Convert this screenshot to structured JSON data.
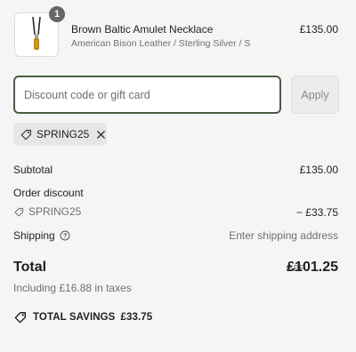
{
  "product": {
    "name": "Brown Baltic Amulet Necklace",
    "variant": "American Bison Leather / Sterling Silver / S",
    "price": "£135.00",
    "quantity": "1",
    "image_icon": "necklace-thumbnail"
  },
  "discount": {
    "placeholder": "Discount code or gift card",
    "value": "",
    "apply_label": "Apply"
  },
  "applied_code_chip": {
    "label": "SPRING25",
    "icon": "tag-icon",
    "remove_icon": "close-icon"
  },
  "summary": {
    "subtotal_label": "Subtotal",
    "subtotal_value": "£135.00",
    "order_discount_label": "Order discount",
    "discount_code": "SPRING25",
    "discount_value": "− £33.75",
    "shipping_label": "Shipping",
    "shipping_value": "Enter shipping address",
    "total_label": "Total",
    "currency": "GBP",
    "total_value": "£101.25",
    "taxes_note": "Including £16.88 in taxes",
    "savings_label": "TOTAL SAVINGS",
    "savings_value": "£33.75"
  },
  "colors": {
    "background": "#f5f5f5",
    "input_border": "#4b5c43",
    "badge": "#666666",
    "muted_text": "#707070"
  }
}
